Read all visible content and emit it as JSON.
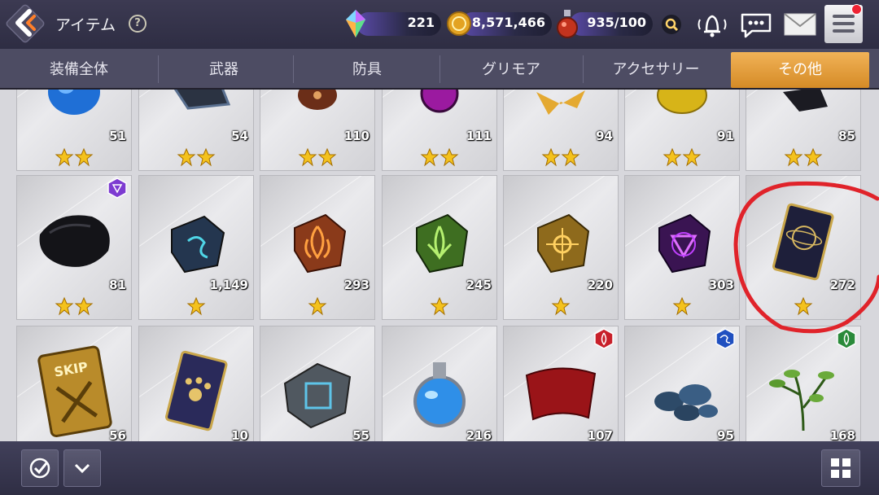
{
  "header": {
    "title": "アイテム",
    "help": "?",
    "crystal": "221",
    "gold": "8,571,466",
    "stamina": "935/100"
  },
  "tabs": [
    {
      "label": "装備全体"
    },
    {
      "label": "武器"
    },
    {
      "label": "防具"
    },
    {
      "label": "グリモア"
    },
    {
      "label": "アクセサリー"
    },
    {
      "label": "その他",
      "active": true
    }
  ],
  "rows": [
    {
      "cells": [
        {
          "count": "51",
          "stars": 2,
          "icon": "blue-potion-icon"
        },
        {
          "count": "54",
          "stars": 2,
          "icon": "dark-box-icon"
        },
        {
          "count": "110",
          "stars": 2,
          "icon": "brown-orb-icon"
        },
        {
          "count": "111",
          "stars": 2,
          "icon": "purple-orb-icon"
        },
        {
          "count": "94",
          "stars": 2,
          "icon": "gold-ribbon-icon"
        },
        {
          "count": "91",
          "stars": 2,
          "icon": "gold-pot-icon"
        },
        {
          "count": "85",
          "stars": 2,
          "icon": "black-stone-icon"
        }
      ]
    },
    {
      "cells": [
        {
          "count": "81",
          "stars": 2,
          "icon": "black-fur-icon",
          "badge": "purple-element-badge"
        },
        {
          "count": "1,149",
          "stars": 1,
          "icon": "blue-rune-stone-icon"
        },
        {
          "count": "293",
          "stars": 1,
          "icon": "fire-rune-stone-icon"
        },
        {
          "count": "245",
          "stars": 1,
          "icon": "leaf-rune-stone-icon"
        },
        {
          "count": "220",
          "stars": 1,
          "icon": "gold-rune-stone-icon"
        },
        {
          "count": "303",
          "stars": 1,
          "icon": "dark-rune-stone-icon"
        },
        {
          "count": "272",
          "stars": 1,
          "icon": "cosmic-card-icon"
        }
      ]
    },
    {
      "cells": [
        {
          "count": "56",
          "icon": "skip-ticket-icon",
          "skip_text": "SKIP"
        },
        {
          "count": "10",
          "icon": "paw-card-icon"
        },
        {
          "count": "55",
          "icon": "blue-slate-icon"
        },
        {
          "count": "216",
          "icon": "blue-flask-icon"
        },
        {
          "count": "107",
          "icon": "red-cloth-icon",
          "badge": "fire-element-badge"
        },
        {
          "count": "95",
          "icon": "blue-pebbles-icon",
          "badge": "water-element-badge"
        },
        {
          "count": "168",
          "icon": "green-herb-icon",
          "badge": "wind-element-badge"
        }
      ]
    }
  ],
  "colors": {
    "accent_tab": "#e39b35",
    "annotation": "#e0232a",
    "star": "#f4c21d"
  }
}
